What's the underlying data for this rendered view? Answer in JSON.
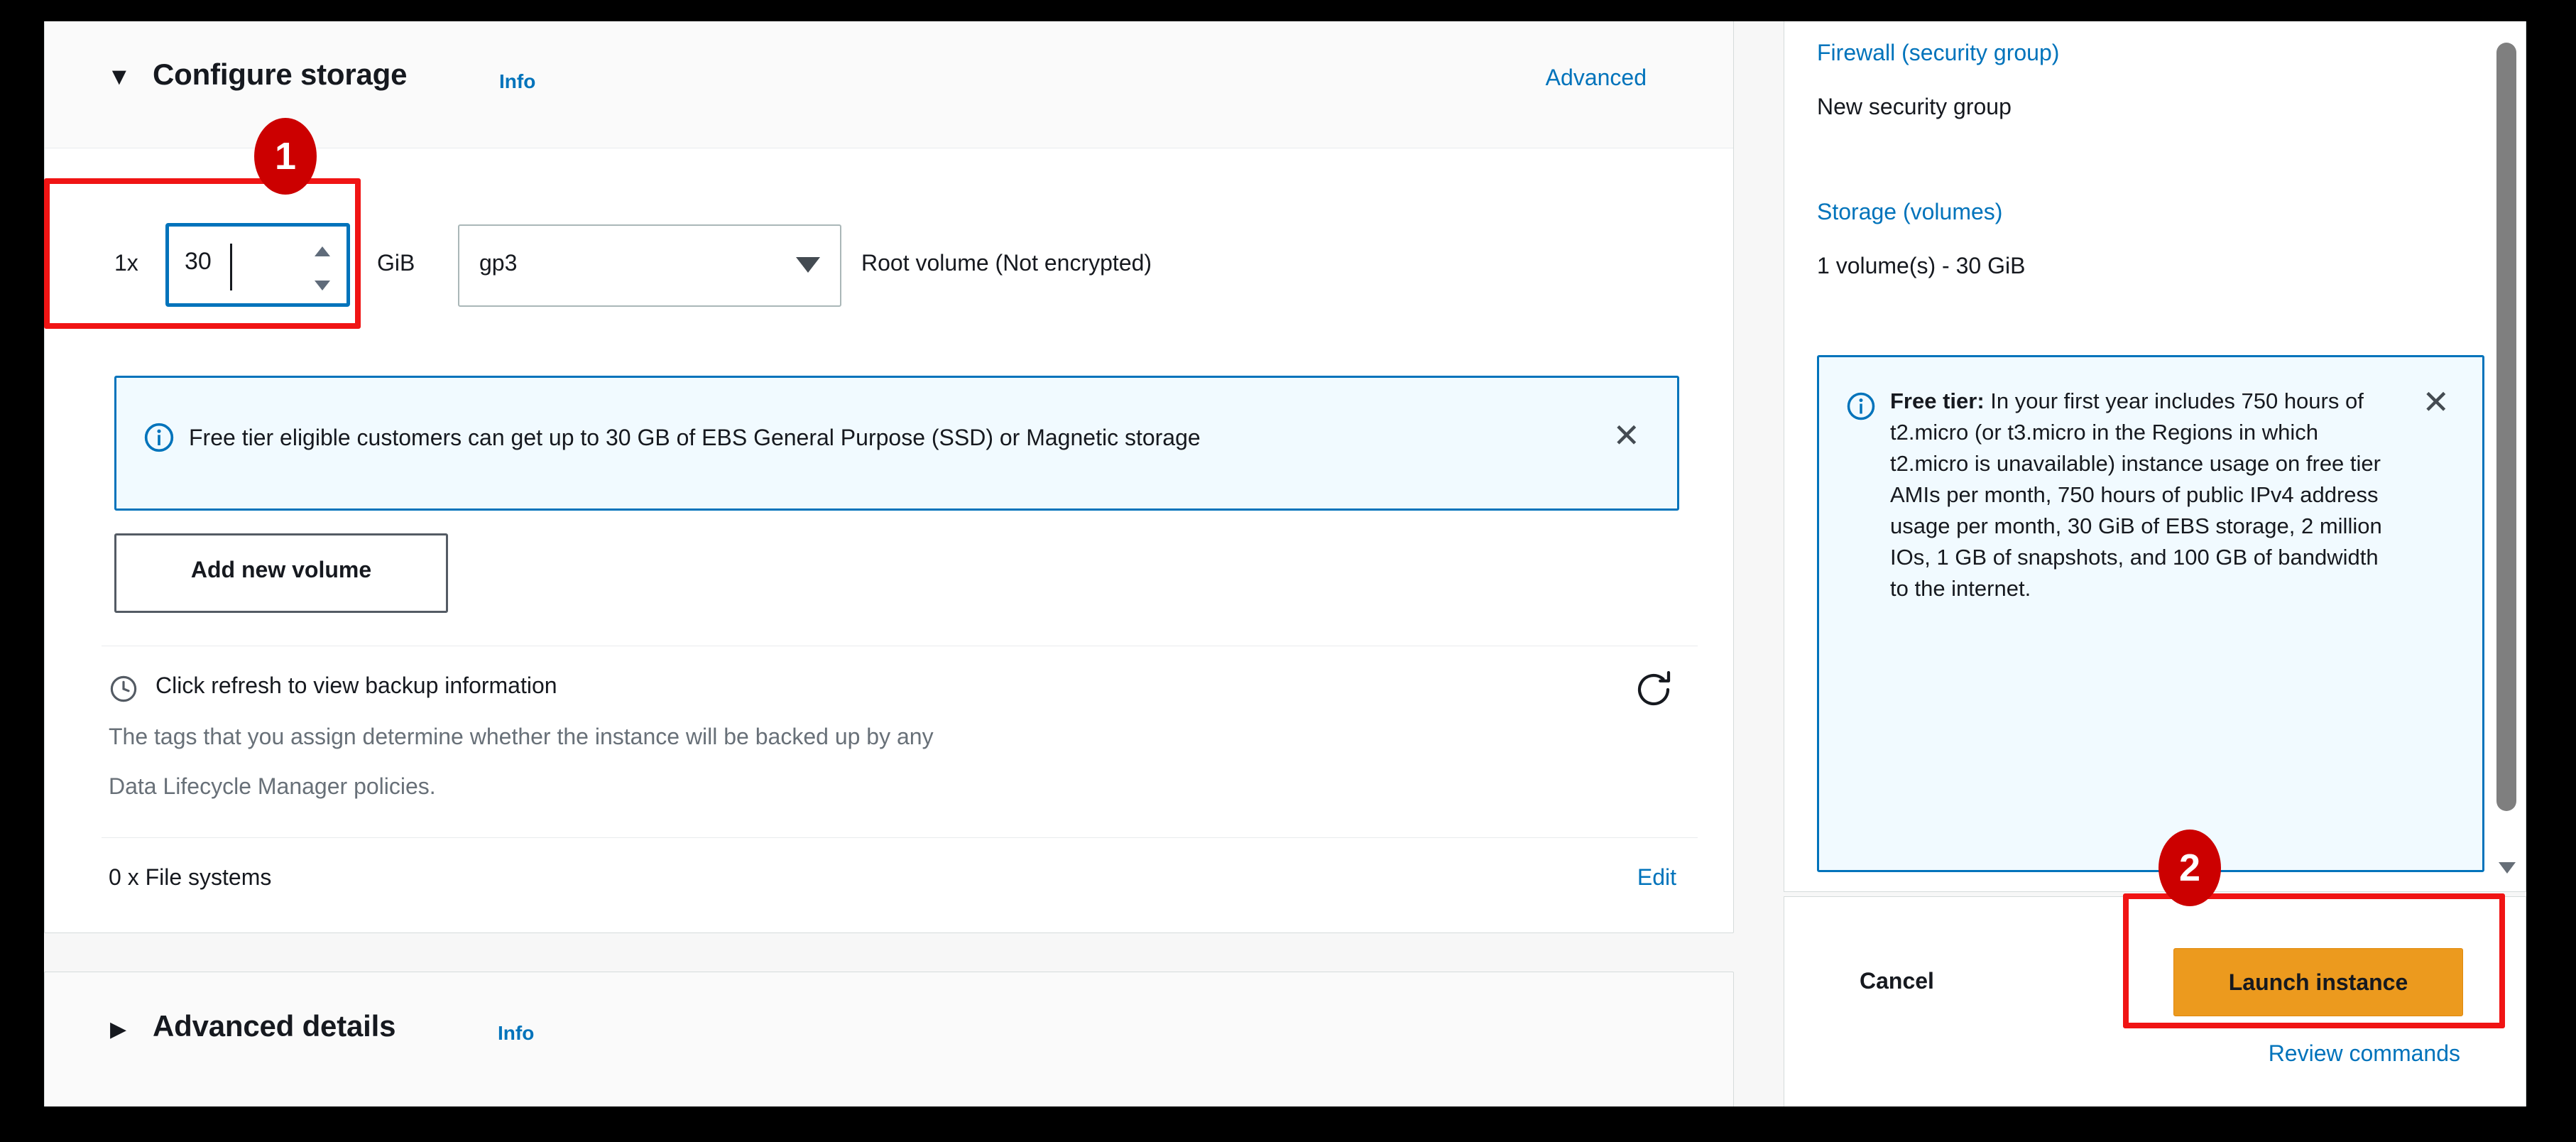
{
  "storage_section": {
    "caret": "▼",
    "title": "Configure storage",
    "info_label": "Info",
    "advanced_label": "Advanced",
    "volume": {
      "multiplier": "1x",
      "size_value": "30",
      "size_unit": "GiB",
      "volume_type": "gp3",
      "description": "Root volume  (Not encrypted)"
    },
    "free_tier_alert": {
      "icon": "info-circle-icon",
      "message": "Free tier eligible customers can get up to 30 GB of EBS General Purpose (SSD) or Magnetic storage",
      "close_glyph": "✕"
    },
    "add_volume_label": "Add new volume",
    "backup": {
      "icon": "clock-icon",
      "title": "Click refresh to view backup information",
      "description_line1": "The tags that you assign determine whether the instance will be backed up by any",
      "description_line2": "Data Lifecycle Manager policies.",
      "refresh_icon": "refresh-icon"
    },
    "file_systems": {
      "label": "0 x File systems",
      "edit_label": "Edit"
    }
  },
  "advanced_section": {
    "caret": "▶",
    "title": "Advanced details",
    "info_label": "Info"
  },
  "summary": {
    "firewall_link": "Firewall (security group)",
    "firewall_value": "New security group",
    "storage_link": "Storage (volumes)",
    "storage_value": "1 volume(s) - 30 GiB",
    "free_tier": {
      "icon": "info-circle-icon",
      "bold_prefix": "Free tier:",
      "text": " In your first year includes 750 hours of t2.micro (or t3.micro in the Regions in which t2.micro is unavailable) instance usage on free tier AMIs per month, 750 hours of public IPv4 address usage per month, 30 GiB of EBS storage, 2 million IOs, 1 GB of snapshots, and 100 GB of bandwidth to the internet.",
      "close_glyph": "✕"
    },
    "scrollbar": "vertical-scrollbar"
  },
  "actions": {
    "cancel_label": "Cancel",
    "launch_label": "Launch instance",
    "review_label": "Review commands"
  },
  "annotations": {
    "step1": "1",
    "step2": "2"
  },
  "colors": {
    "accent_blue": "#0073bb",
    "launch_orange": "#ec9a1e",
    "annotation_red": "#f01414",
    "badge_red": "#cc0000",
    "alert_bg": "#f1faff"
  }
}
